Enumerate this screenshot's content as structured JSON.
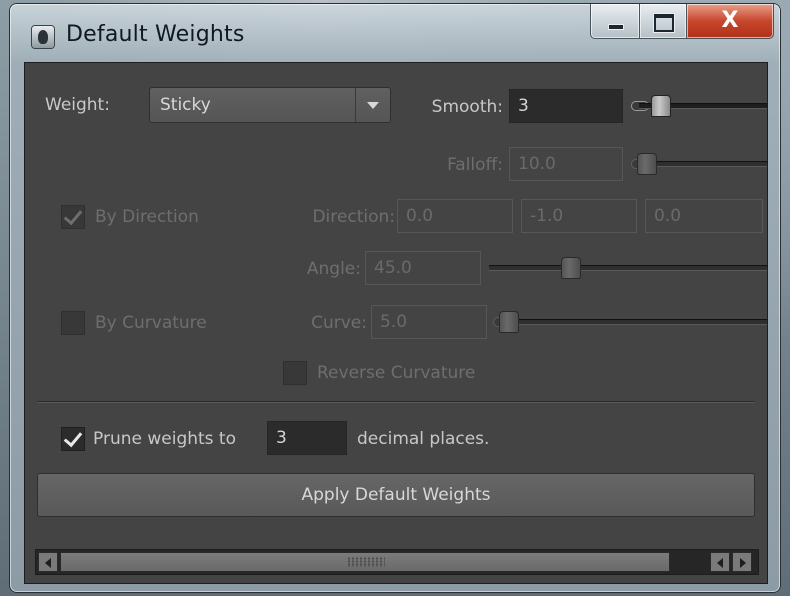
{
  "window": {
    "title": "Default Weights",
    "close_glyph": "X"
  },
  "icons": {
    "app": "maya-app-icon",
    "minimize": "minimize-icon",
    "maximize": "maximize-icon",
    "close": "close-icon"
  },
  "weight": {
    "label": "Weight:",
    "selected": "Sticky"
  },
  "smooth": {
    "label": "Smooth:",
    "value": "3",
    "slider_level": 0.23
  },
  "falloff": {
    "label": "Falloff:",
    "value": "10.0",
    "slider_level": 0.1
  },
  "by_direction": {
    "label": "By Direction",
    "checked": true,
    "direction_label": "Direction:",
    "x": "0.0",
    "y": "-1.0",
    "z": "0.0"
  },
  "angle": {
    "label": "Angle:",
    "value": "45.0",
    "slider_level": 0.27
  },
  "by_curvature": {
    "label": "By Curvature",
    "checked": false,
    "curve_label": "Curve:",
    "curve_value": "5.0"
  },
  "reverse_curvature": {
    "label": "Reverse Curvature",
    "checked": false
  },
  "prune": {
    "label": "Prune weights to",
    "checked": true,
    "value": "3",
    "suffix": "decimal places."
  },
  "apply_button": "Apply Default Weights",
  "colors": {
    "panel_bg": "#444444",
    "field_bg": "#2b2b2b",
    "text": "#c8c8c8",
    "disabled_text": "#6e6e6e",
    "close_red": "#c7472c"
  }
}
